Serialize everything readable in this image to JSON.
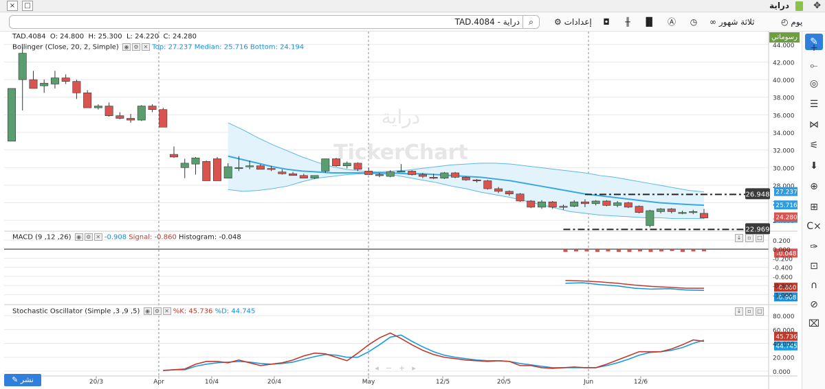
{
  "window": {
    "title": "دراية",
    "close_label": "×",
    "restore_label": "□"
  },
  "toolbar": {
    "symbol_text": "TAD.4084 - دراية",
    "settings_label": "إعدادات",
    "period_label": "ثلاثة شهور",
    "interval_label": "يوم"
  },
  "watermark": {
    "arabic": "دراية",
    "brand": "TickerChart"
  },
  "chart_tab_label": "رسوماتي",
  "share_label": "نشر",
  "ohlc": {
    "symbol": "TAD.4084",
    "o_label": "O:",
    "o": "24.800",
    "h_label": "H:",
    "h": "25.300",
    "l_label": "L:",
    "l": "24.220",
    "c_label": "C:",
    "c": "24.280"
  },
  "indicators": {
    "bollinger": {
      "name": "Bollinger (Close, 20, 2, Simple)",
      "top_label": "Top:",
      "top": "27.237",
      "median_label": "Median:",
      "median": "25.716",
      "bottom_label": "Bottom:",
      "bottom": "24.194"
    },
    "macd": {
      "name": "MACD (9 ,12 ,26)",
      "value": "-0.908",
      "signal_label": "Signal:",
      "signal": "-0.860",
      "hist_label": "Histogram:",
      "hist": "-0.048"
    },
    "stoch": {
      "name": "Stochastic Oscillator (Simple ,3 ,9 ,5)",
      "k_label": "%K:",
      "k": "45.736",
      "d_label": "%D:",
      "d": "44.745"
    }
  },
  "colors": {
    "up": "#5a9e6f",
    "down": "#d9534f",
    "band_line": "#5bb8e8",
    "band_fill": "#e3f3fc",
    "median": "#3aa8e0",
    "macd_line": "#1a8ed8",
    "signal_line": "#c0392b",
    "k_line": "#c0392b",
    "d_line": "#1a9be0",
    "grid": "#e8e8e8",
    "vline": "#8a8a8a"
  },
  "chart_data": {
    "type": "candlestick",
    "x_labels": [
      "20/3",
      "Apr",
      "10/4",
      "20/4",
      "May",
      "12/5",
      "20/5",
      "Jun",
      "12/6"
    ],
    "price_axis": [
      "44.000",
      "42.000",
      "40.000",
      "38.000",
      "36.000",
      "34.000",
      "32.000",
      "30.000",
      "28.000",
      "26.000",
      "24.000"
    ],
    "price_range": [
      23.0,
      45.0
    ],
    "candles": [
      [
        33.0,
        39.0,
        33.0,
        39.0
      ],
      [
        40.0,
        43.7,
        36.5,
        43.0
      ],
      [
        40.0,
        41.0,
        39.0,
        39.0
      ],
      [
        39.3,
        40.0,
        38.5,
        39.6
      ],
      [
        39.5,
        41.0,
        39.0,
        40.2
      ],
      [
        40.2,
        40.6,
        39.5,
        39.8
      ],
      [
        39.8,
        40.0,
        37.8,
        38.5
      ],
      [
        38.5,
        38.8,
        36.8,
        36.8
      ],
      [
        36.8,
        37.2,
        36.6,
        37.0
      ],
      [
        37.0,
        37.4,
        35.8,
        35.9
      ],
      [
        35.9,
        36.3,
        35.5,
        35.6
      ],
      [
        35.6,
        36.1,
        35.1,
        35.4
      ],
      [
        35.4,
        37.1,
        35.3,
        37.0
      ],
      [
        37.0,
        37.2,
        36.3,
        36.6
      ],
      [
        36.6,
        36.8,
        34.6,
        34.6
      ],
      [
        31.5,
        32.4,
        31.1,
        31.2
      ],
      [
        30.0,
        31.0,
        28.8,
        30.5
      ],
      [
        30.4,
        31.2,
        29.2,
        31.1
      ],
      [
        30.7,
        30.8,
        28.5,
        28.5
      ],
      [
        31.0,
        31.2,
        28.6,
        28.5
      ],
      [
        28.8,
        30.5,
        28.8,
        30.1
      ],
      [
        30.0,
        31.3,
        29.6,
        30.0
      ],
      [
        30.2,
        30.8,
        29.8,
        30.2
      ],
      [
        30.2,
        30.4,
        29.9,
        29.8
      ],
      [
        29.9,
        30.2,
        29.6,
        29.8
      ],
      [
        29.5,
        29.8,
        29.2,
        29.3
      ],
      [
        29.3,
        29.5,
        29.1,
        29.1
      ],
      [
        29.1,
        29.3,
        28.8,
        28.8
      ],
      [
        28.8,
        29.1,
        28.7,
        29.1
      ],
      [
        29.6,
        31.0,
        29.4,
        31.0
      ],
      [
        31.0,
        31.1,
        30.1,
        30.2
      ],
      [
        30.2,
        30.7,
        29.9,
        30.5
      ],
      [
        30.5,
        30.6,
        29.6,
        29.8
      ],
      [
        29.6,
        30.0,
        29.2,
        29.2
      ],
      [
        29.2,
        29.4,
        28.9,
        29.1
      ],
      [
        29.0,
        29.7,
        28.9,
        29.5
      ],
      [
        29.6,
        30.4,
        29.5,
        29.6
      ],
      [
        29.6,
        29.7,
        29.1,
        29.2
      ],
      [
        29.2,
        29.4,
        28.8,
        29.0
      ],
      [
        28.9,
        29.3,
        28.7,
        28.8
      ],
      [
        28.8,
        29.5,
        28.7,
        29.4
      ],
      [
        29.4,
        29.5,
        28.8,
        28.9
      ],
      [
        28.9,
        29.0,
        28.5,
        28.6
      ],
      [
        28.6,
        28.7,
        28.3,
        28.5
      ],
      [
        28.5,
        28.6,
        27.5,
        27.6
      ],
      [
        27.6,
        27.8,
        27.1,
        27.3
      ],
      [
        27.3,
        27.4,
        26.8,
        27.0
      ],
      [
        27.0,
        27.1,
        26.1,
        26.2
      ],
      [
        26.2,
        26.3,
        25.4,
        25.5
      ],
      [
        25.5,
        26.3,
        25.3,
        26.1
      ],
      [
        26.1,
        26.2,
        25.3,
        25.5
      ],
      [
        25.5,
        25.8,
        25.2,
        25.6
      ],
      [
        25.6,
        26.3,
        25.5,
        26.1
      ],
      [
        26.1,
        26.4,
        25.5,
        25.9
      ],
      [
        25.9,
        26.3,
        25.7,
        26.2
      ],
      [
        26.2,
        26.3,
        25.6,
        25.7
      ],
      [
        25.7,
        26.2,
        25.5,
        26.0
      ],
      [
        26.0,
        26.1,
        25.4,
        25.5
      ],
      [
        25.6,
        25.7,
        24.8,
        24.9
      ],
      [
        23.4,
        25.2,
        23.2,
        25.1
      ],
      [
        25.0,
        25.4,
        24.8,
        25.3
      ],
      [
        25.3,
        25.4,
        24.8,
        25.0
      ],
      [
        24.9,
        25.1,
        24.7,
        24.9
      ],
      [
        24.9,
        25.2,
        24.7,
        25.0
      ],
      [
        24.8,
        25.3,
        24.2,
        24.28
      ]
    ],
    "boll_top": [
      35.1,
      34.3,
      33.4,
      32.6,
      31.9,
      31.2,
      30.6,
      30.1,
      29.8,
      29.6,
      29.5,
      29.6,
      29.7,
      29.9,
      30.1,
      30.3,
      30.4,
      30.5,
      30.5,
      30.4,
      30.2,
      30.0,
      29.8,
      29.6,
      29.4,
      29.1,
      28.9,
      28.6,
      28.3,
      28.0,
      27.7,
      27.4,
      27.237
    ],
    "boll_mid": [
      31.3,
      30.9,
      30.5,
      30.1,
      29.8,
      29.6,
      29.5,
      29.4,
      29.4,
      29.4,
      29.4,
      29.4,
      29.3,
      29.3,
      29.2,
      29.1,
      29.0,
      28.9,
      28.7,
      28.5,
      28.2,
      27.9,
      27.6,
      27.3,
      27.0,
      26.8,
      26.6,
      26.4,
      26.2,
      26.0,
      25.9,
      25.8,
      25.716
    ],
    "boll_bot": [
      27.5,
      27.3,
      27.4,
      27.6,
      27.9,
      28.4,
      28.8,
      29.0,
      29.2,
      29.3,
      29.3,
      29.2,
      28.9,
      28.6,
      28.3,
      27.9,
      27.6,
      27.2,
      26.9,
      26.6,
      26.2,
      25.8,
      25.4,
      25.0,
      24.8,
      24.6,
      24.5,
      24.4,
      24.3,
      24.3,
      24.2,
      24.2,
      24.194
    ],
    "boll_start_index": 20,
    "levels": [
      "26.948",
      "22.969"
    ],
    "level_values": [
      26.948,
      22.969
    ],
    "last_price": "24.280",
    "macd_axis": [
      "0.200",
      "0.000",
      "-0.200",
      "-0.400",
      "-0.600",
      "-0.800",
      "-1.000"
    ],
    "macd_range": [
      -1.1,
      0.32
    ],
    "macd_hist": [
      -0.06,
      -0.05,
      -0.05,
      -0.06,
      -0.05,
      -0.06,
      -0.06,
      -0.05,
      -0.06,
      -0.05,
      -0.04,
      -0.06,
      -0.05,
      -0.048
    ],
    "macd_line": [
      -0.75,
      -0.74,
      -0.78,
      -0.81,
      -0.86,
      -0.88,
      -0.87,
      -0.9,
      -0.908
    ],
    "signal_line": [
      -0.69,
      -0.7,
      -0.72,
      -0.75,
      -0.79,
      -0.82,
      -0.84,
      -0.86,
      -0.86
    ],
    "stoch_axis": [
      "80.000",
      "60.000",
      "40.000",
      "20.000",
      "0.000"
    ],
    "stoch_range": [
      -5,
      90
    ],
    "stoch_k": [
      1,
      2,
      3,
      10,
      14,
      14,
      12,
      16,
      12,
      8,
      10,
      12,
      16,
      22,
      26,
      25,
      20,
      15,
      26,
      38,
      48,
      55,
      47,
      38,
      30,
      24,
      20,
      18,
      16,
      15,
      14,
      15,
      14,
      8,
      8,
      5,
      4,
      5,
      6,
      5,
      5,
      10,
      16,
      22,
      28,
      28,
      28,
      32,
      38,
      45,
      43
    ],
    "stoch_d": [
      1,
      2,
      2,
      7,
      10,
      12,
      13,
      14,
      13,
      11,
      10,
      11,
      13,
      17,
      21,
      24,
      23,
      20,
      20,
      28,
      38,
      49,
      52,
      43,
      35,
      28,
      23,
      20,
      18,
      16,
      15,
      15,
      14,
      11,
      9,
      7,
      5,
      5,
      5,
      5,
      5,
      8,
      12,
      17,
      23,
      27,
      28,
      30,
      34,
      40,
      44.7
    ]
  }
}
